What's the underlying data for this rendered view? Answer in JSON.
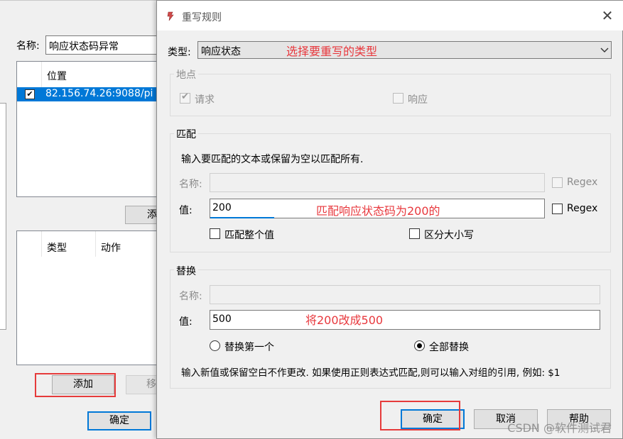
{
  "background_window": {
    "name_label": "名称:",
    "name_value": "响应状态码异常",
    "list_header_location": "位置",
    "list_row_text": "82.156.74.26:9088/pi",
    "add_button_partial": "添",
    "actions_header_type": "类型",
    "actions_header_action": "动作",
    "add_button": "添加",
    "move_button_partial": "移",
    "ok_button": "确定"
  },
  "dialog": {
    "title": "重写规则",
    "close_icon": "close-icon",
    "type_label": "类型:",
    "type_value": "响应状态",
    "type_annotation": "选择要重写的类型",
    "location_group": {
      "title": "地点",
      "request_label": "请求",
      "request_checked": true,
      "response_label": "响应",
      "response_checked": false
    },
    "match_group": {
      "title": "匹配",
      "hint": "输入要匹配的文本或保留为空以匹配所有.",
      "name_label": "名称:",
      "name_value": "",
      "name_regex_label": "Regex",
      "value_label": "值:",
      "value": "200",
      "value_annotation": "匹配响应状态码为200的",
      "value_regex_label": "Regex",
      "whole_value_label": "匹配整个值",
      "case_sensitive_label": "区分大小写"
    },
    "replace_group": {
      "title": "替换",
      "name_label": "名称:",
      "name_value": "",
      "value_label": "值:",
      "value": "500",
      "value_annotation": "将200改成500",
      "replace_first_label": "替换第一个",
      "replace_all_label": "全部替换",
      "selected_option": "全部替换",
      "hint": "输入新值或保留空白不作更改. 如果使用正则表达式匹配,则可以输入对组的引用, 例如: $1"
    },
    "buttons": {
      "ok": "确定",
      "cancel": "取消",
      "help": "帮助"
    }
  },
  "watermark": "CSDN @软件测试君",
  "colors": {
    "annotation_red": "#e8383d",
    "selection_blue": "#0078d7"
  }
}
